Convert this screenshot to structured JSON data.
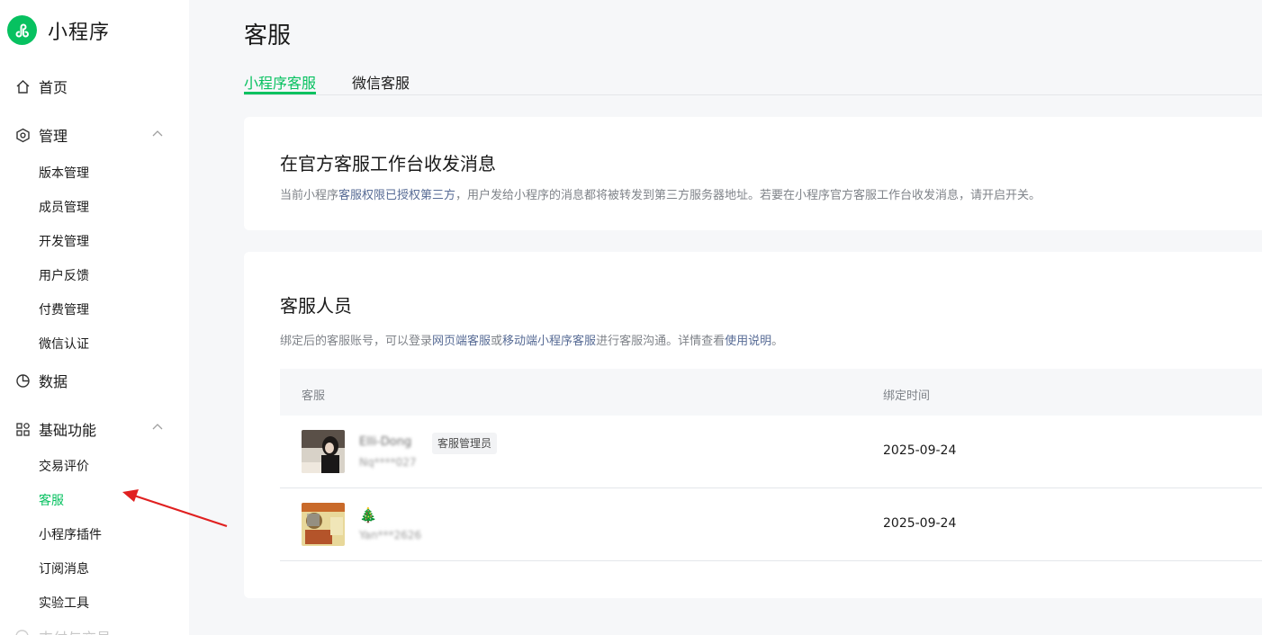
{
  "app": {
    "name": "小程序",
    "logo_color": "#07c160"
  },
  "sidebar": {
    "home": {
      "label": "首页",
      "icon": "home-icon"
    },
    "manage": {
      "label": "管理",
      "icon": "settings-hex-icon",
      "items": [
        "版本管理",
        "成员管理",
        "开发管理",
        "用户反馈",
        "付费管理",
        "微信认证"
      ]
    },
    "data": {
      "label": "数据",
      "icon": "pie-chart-icon"
    },
    "basic": {
      "label": "基础功能",
      "icon": "grid-icon",
      "items": [
        "交易评价",
        "客服",
        "小程序插件",
        "订阅消息",
        "实验工具"
      ],
      "active_index": 1
    },
    "faded_next": {
      "label": "支付与交易"
    }
  },
  "page": {
    "title": "客服"
  },
  "tabs": [
    {
      "label": "小程序客服",
      "active": true
    },
    {
      "label": "微信客服",
      "active": false
    }
  ],
  "workbench": {
    "title": "在官方客服工作台收发消息",
    "desc_prefix": "当前小程序",
    "desc_link": "客服权限已授权第三方",
    "desc_suffix": "，用户发给小程序的消息都将被转发到第三方服务器地址。若要在小程序官方客服工作台收发消息，请开启开关。"
  },
  "staff": {
    "title": "客服人员",
    "desc_1": "绑定后的客服账号，可以登录",
    "link_web": "网页端客服",
    "desc_2": "或",
    "link_mobile": "移动端小程序客服",
    "desc_3": "进行客服沟通。详情查看",
    "link_help": "使用说明",
    "desc_4": "。",
    "columns": [
      "客服",
      "绑定时间"
    ],
    "rows": [
      {
        "name": "Elli-Dong",
        "id": "Nq****027",
        "badge": "客服管理员",
        "date": "2025-09-24"
      },
      {
        "name": "🎄",
        "id": "Yan***2626",
        "badge": "",
        "date": "2025-09-24"
      }
    ]
  },
  "annotation": {
    "arrow_color": "#e02020"
  },
  "colors": {
    "accent": "#07c160",
    "link": "#576b95",
    "muted": "#7f8389"
  }
}
